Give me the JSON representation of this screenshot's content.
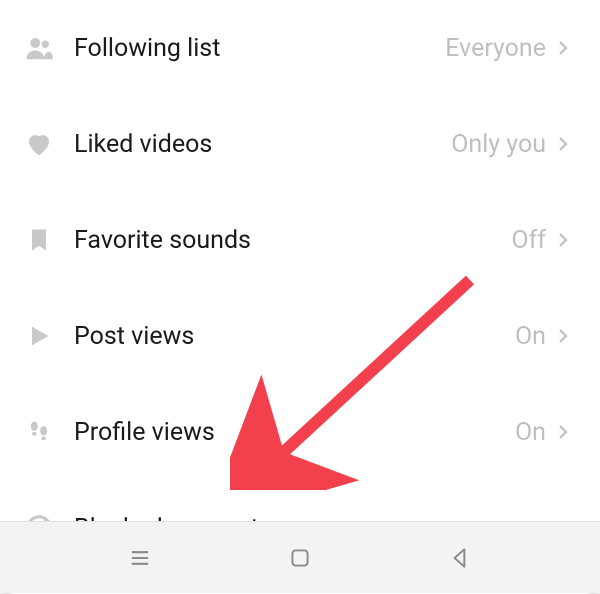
{
  "settings": {
    "rows": [
      {
        "label": "Following list",
        "value": "Everyone"
      },
      {
        "label": "Liked videos",
        "value": "Only you"
      },
      {
        "label": "Favorite sounds",
        "value": "Off"
      },
      {
        "label": "Post views",
        "value": "On"
      },
      {
        "label": "Profile views",
        "value": "On"
      },
      {
        "label": "Blocked accounts",
        "value": ""
      }
    ]
  }
}
